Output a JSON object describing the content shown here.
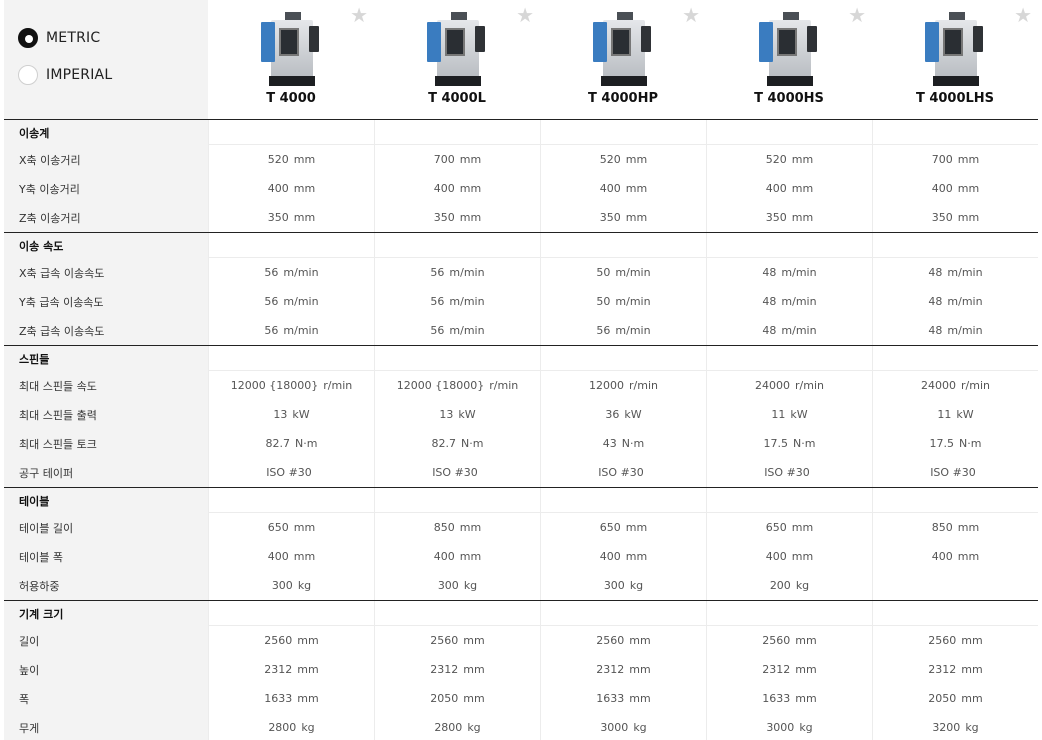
{
  "unit_options": [
    {
      "label": "METRIC",
      "selected": true
    },
    {
      "label": "IMPERIAL",
      "selected": false
    }
  ],
  "products": [
    {
      "name": "T 4000"
    },
    {
      "name": "T 4000L"
    },
    {
      "name": "T 4000HP"
    },
    {
      "name": "T 4000HS"
    },
    {
      "name": "T 4000LHS"
    }
  ],
  "sections": [
    {
      "title": "이송계",
      "rows": [
        {
          "label": "X축 이송거리",
          "values": [
            [
              "520",
              "mm"
            ],
            [
              "700",
              "mm"
            ],
            [
              "520",
              "mm"
            ],
            [
              "520",
              "mm"
            ],
            [
              "700",
              "mm"
            ]
          ]
        },
        {
          "label": "Y축 이송거리",
          "values": [
            [
              "400",
              "mm"
            ],
            [
              "400",
              "mm"
            ],
            [
              "400",
              "mm"
            ],
            [
              "400",
              "mm"
            ],
            [
              "400",
              "mm"
            ]
          ]
        },
        {
          "label": "Z축 이송거리",
          "values": [
            [
              "350",
              "mm"
            ],
            [
              "350",
              "mm"
            ],
            [
              "350",
              "mm"
            ],
            [
              "350",
              "mm"
            ],
            [
              "350",
              "mm"
            ]
          ]
        }
      ]
    },
    {
      "title": "이송 속도",
      "rows": [
        {
          "label": "X축 급속 이송속도",
          "values": [
            [
              "56",
              "m/min"
            ],
            [
              "56",
              "m/min"
            ],
            [
              "50",
              "m/min"
            ],
            [
              "48",
              "m/min"
            ],
            [
              "48",
              "m/min"
            ]
          ]
        },
        {
          "label": "Y축 급속 이송속도",
          "values": [
            [
              "56",
              "m/min"
            ],
            [
              "56",
              "m/min"
            ],
            [
              "50",
              "m/min"
            ],
            [
              "48",
              "m/min"
            ],
            [
              "48",
              "m/min"
            ]
          ]
        },
        {
          "label": "Z축 급속 이송속도",
          "values": [
            [
              "56",
              "m/min"
            ],
            [
              "56",
              "m/min"
            ],
            [
              "56",
              "m/min"
            ],
            [
              "48",
              "m/min"
            ],
            [
              "48",
              "m/min"
            ]
          ]
        }
      ]
    },
    {
      "title": "스핀들",
      "rows": [
        {
          "label": "최대 스핀들 속도",
          "values": [
            [
              "12000 {18000}",
              "r/min"
            ],
            [
              "12000 {18000}",
              "r/min"
            ],
            [
              "12000",
              "r/min"
            ],
            [
              "24000",
              "r/min"
            ],
            [
              "24000",
              "r/min"
            ]
          ]
        },
        {
          "label": "최대 스핀들 출력",
          "values": [
            [
              "13",
              "kW"
            ],
            [
              "13",
              "kW"
            ],
            [
              "36",
              "kW"
            ],
            [
              "11",
              "kW"
            ],
            [
              "11",
              "kW"
            ]
          ]
        },
        {
          "label": "최대 스핀들 토크",
          "values": [
            [
              "82.7",
              "N·m"
            ],
            [
              "82.7",
              "N·m"
            ],
            [
              "43",
              "N·m"
            ],
            [
              "17.5",
              "N·m"
            ],
            [
              "17.5",
              "N·m"
            ]
          ]
        },
        {
          "label": "공구 테이퍼",
          "values": [
            [
              "ISO #30",
              ""
            ],
            [
              "ISO #30",
              ""
            ],
            [
              "ISO #30",
              ""
            ],
            [
              "ISO #30",
              ""
            ],
            [
              "ISO #30",
              ""
            ]
          ]
        }
      ]
    },
    {
      "title": "테이블",
      "rows": [
        {
          "label": "테이블 길이",
          "values": [
            [
              "650",
              "mm"
            ],
            [
              "850",
              "mm"
            ],
            [
              "650",
              "mm"
            ],
            [
              "650",
              "mm"
            ],
            [
              "850",
              "mm"
            ]
          ]
        },
        {
          "label": "테이블 폭",
          "values": [
            [
              "400",
              "mm"
            ],
            [
              "400",
              "mm"
            ],
            [
              "400",
              "mm"
            ],
            [
              "400",
              "mm"
            ],
            [
              "400",
              "mm"
            ]
          ]
        },
        {
          "label": "허용하중",
          "values": [
            [
              "300",
              "kg"
            ],
            [
              "300",
              "kg"
            ],
            [
              "300",
              "kg"
            ],
            [
              "200",
              "kg"
            ],
            [
              "",
              ""
            ]
          ]
        }
      ]
    },
    {
      "title": "기계 크기",
      "rows": [
        {
          "label": "길이",
          "values": [
            [
              "2560",
              "mm"
            ],
            [
              "2560",
              "mm"
            ],
            [
              "2560",
              "mm"
            ],
            [
              "2560",
              "mm"
            ],
            [
              "2560",
              "mm"
            ]
          ]
        },
        {
          "label": "높이",
          "values": [
            [
              "2312",
              "mm"
            ],
            [
              "2312",
              "mm"
            ],
            [
              "2312",
              "mm"
            ],
            [
              "2312",
              "mm"
            ],
            [
              "2312",
              "mm"
            ]
          ]
        },
        {
          "label": "폭",
          "values": [
            [
              "1633",
              "mm"
            ],
            [
              "2050",
              "mm"
            ],
            [
              "1633",
              "mm"
            ],
            [
              "1633",
              "mm"
            ],
            [
              "2050",
              "mm"
            ]
          ]
        },
        {
          "label": "무게",
          "values": [
            [
              "2800",
              "kg"
            ],
            [
              "2800",
              "kg"
            ],
            [
              "3000",
              "kg"
            ],
            [
              "3000",
              "kg"
            ],
            [
              "3200",
              "kg"
            ]
          ]
        }
      ]
    }
  ]
}
